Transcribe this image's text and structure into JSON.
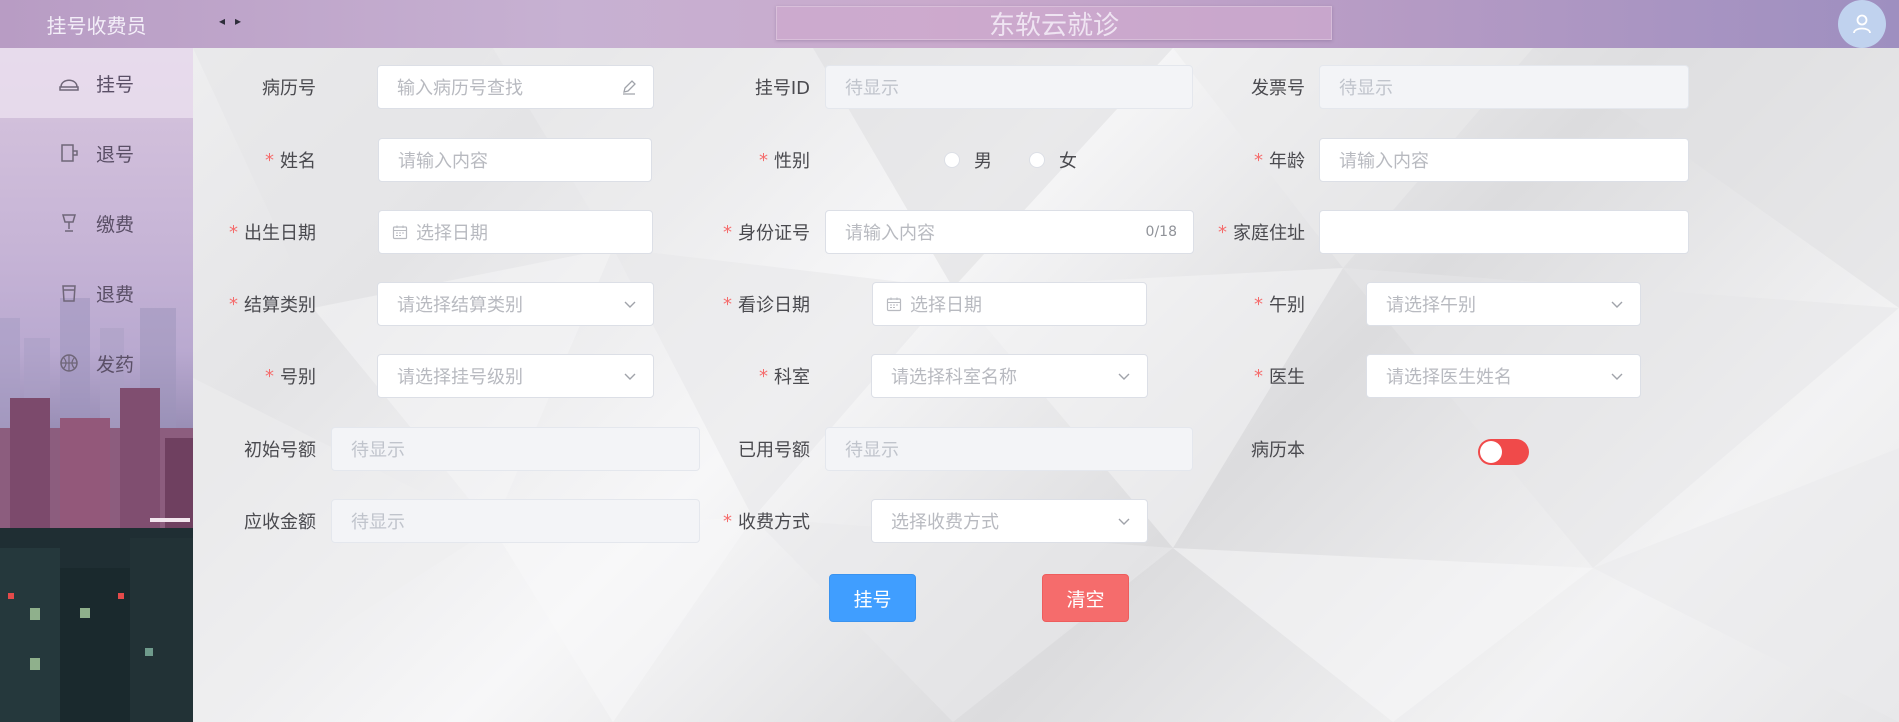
{
  "header": {
    "app_name": "挂号收费员",
    "title": "东软云就诊"
  },
  "sidebar": {
    "items": [
      {
        "label": "挂号",
        "icon": "hat-icon"
      },
      {
        "label": "退号",
        "icon": "exit-icon"
      },
      {
        "label": "缴费",
        "icon": "goblet-icon"
      },
      {
        "label": "退费",
        "icon": "cup-icon"
      },
      {
        "label": "发药",
        "icon": "basketball-icon"
      }
    ]
  },
  "form": {
    "medical_record": {
      "label": "病历号",
      "placeholder": "输入病历号查找"
    },
    "register_id": {
      "label": "挂号ID",
      "placeholder": "待显示"
    },
    "invoice": {
      "label": "发票号",
      "placeholder": "待显示"
    },
    "name": {
      "label": "姓名",
      "placeholder": "请输入内容"
    },
    "gender": {
      "label": "性别",
      "options": [
        "男",
        "女"
      ]
    },
    "age": {
      "label": "年龄",
      "placeholder": "请输入内容"
    },
    "birth_date": {
      "label": "出生日期",
      "placeholder": "选择日期"
    },
    "id_card": {
      "label": "身份证号",
      "placeholder": "请输入内容",
      "counter": "0/18"
    },
    "address": {
      "label": "家庭住址",
      "placeholder": ""
    },
    "settlement": {
      "label": "结算类别",
      "placeholder": "请选择结算类别"
    },
    "visit_date": {
      "label": "看诊日期",
      "placeholder": "选择日期"
    },
    "noon": {
      "label": "午别",
      "placeholder": "请选择午别"
    },
    "level": {
      "label": "号别",
      "placeholder": "请选择挂号级别"
    },
    "dept": {
      "label": "科室",
      "placeholder": "请选择科室名称"
    },
    "doctor": {
      "label": "医生",
      "placeholder": "请选择医生姓名"
    },
    "initial_quota": {
      "label": "初始号额",
      "placeholder": "待显示"
    },
    "used_quota": {
      "label": "已用号额",
      "placeholder": "待显示"
    },
    "record_book": {
      "label": "病历本",
      "on": true
    },
    "receivable": {
      "label": "应收金额",
      "placeholder": "待显示"
    },
    "payment": {
      "label": "收费方式",
      "placeholder": "选择收费方式"
    }
  },
  "actions": {
    "register": "挂号",
    "clear": "清空"
  },
  "colors": {
    "primary": "#409eff",
    "danger": "#f56c6c",
    "switch_on": "#f04a4a",
    "required": "#f56c6c"
  }
}
